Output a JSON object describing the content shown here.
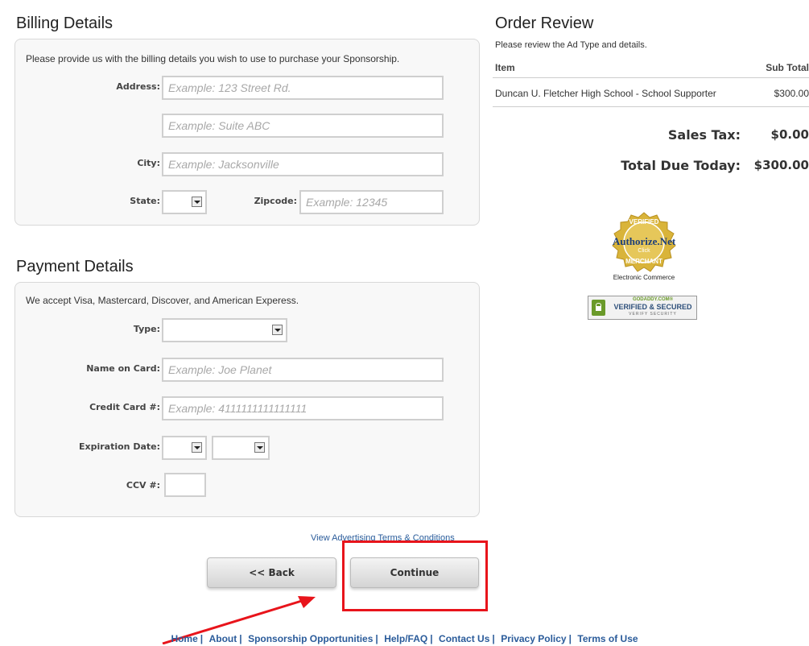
{
  "billing": {
    "title": "Billing Details",
    "intro": "Please provide us with the billing details you wish to use to purchase your Sponsorship.",
    "address_label": "Address:",
    "address1_placeholder": "Example: 123 Street Rd.",
    "address2_placeholder": "Example: Suite ABC",
    "city_label": "City:",
    "city_placeholder": "Example: Jacksonville",
    "state_label": "State:",
    "zip_label": "Zipcode:",
    "zip_placeholder": "Example: 12345"
  },
  "payment": {
    "title": "Payment Details",
    "intro": "We accept Visa, Mastercard, Discover, and American Experess.",
    "type_label": "Type:",
    "name_label": "Name on Card:",
    "name_placeholder": "Example: Joe Planet",
    "cc_label": "Credit Card #:",
    "cc_placeholder": "Example: 4111111111111111",
    "exp_label": "Expiration Date:",
    "ccv_label": "CCV #:"
  },
  "order": {
    "title": "Order Review",
    "subtitle": "Please review the Ad Type and details.",
    "col_item": "Item",
    "col_subtotal": "Sub Total",
    "item_name": "Duncan U. Fletcher High School - School Supporter",
    "item_price": "$300.00",
    "sales_tax_label": "Sales Tax:",
    "sales_tax_value": "$0.00",
    "total_label": "Total Due Today:",
    "total_value": "$300.00"
  },
  "badges": {
    "authorize_top": "VERIFIED",
    "authorize_brand": "Authorize.Net",
    "authorize_click": "Click",
    "authorize_bottom": "MERCHANT",
    "authorize_caption": "Electronic Commerce",
    "godaddy_top": "GODADDY.COM®",
    "godaddy_main": "VERIFIED & SECURED",
    "godaddy_sub": "VERIFY SECURITY"
  },
  "terms_link": "View Advertising Terms & Conditions",
  "buttons": {
    "back": "<< Back",
    "continue": "Continue"
  },
  "footer": {
    "links": [
      "Home",
      "About",
      "Sponsorship Opportunities",
      "Help/FAQ",
      "Contact Us",
      "Privacy Policy",
      "Terms of Use"
    ],
    "separator": "|"
  },
  "colors": {
    "highlight": "#e8141b",
    "link": "#2a5b9a"
  }
}
